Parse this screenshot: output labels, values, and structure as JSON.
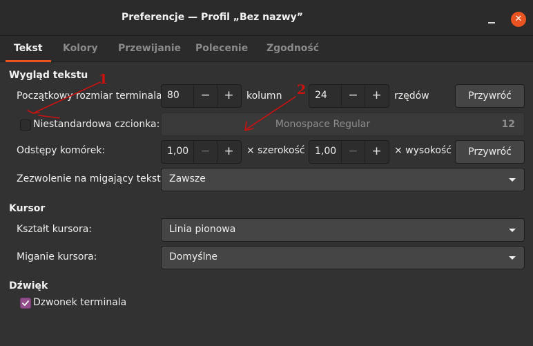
{
  "window": {
    "title": "Preferencje — Profil „Bez nazwy”",
    "minimize_glyph": "—",
    "close_glyph": "✕"
  },
  "tabs": [
    {
      "label": "Tekst",
      "active": true
    },
    {
      "label": "Kolory",
      "active": false
    },
    {
      "label": "Przewijanie",
      "active": false
    },
    {
      "label": "Polecenie",
      "active": false
    },
    {
      "label": "Zgodność",
      "active": false
    }
  ],
  "text_appearance": {
    "heading": "Wygląd tekstu",
    "initial_size_label": "Początkowy rozmiar terminala:",
    "columns_value": "80",
    "columns_unit": "kolumn",
    "rows_value": "24",
    "rows_unit": "rzędów",
    "size_reset_label": "Przywróć",
    "custom_font_label": "Niestandardowa czcionka:",
    "custom_font_checked": false,
    "font_name": "Monospace Regular",
    "font_size": "12",
    "cell_spacing_label": "Odstępy komórek:",
    "width_value": "1,00",
    "width_unit": "× szerokość",
    "height_value": "1,00",
    "height_unit": "× wysokość",
    "spacing_reset_label": "Przywróć",
    "blink_label": "Zezwolenie na migający tekst:",
    "blink_value": "Zawsze"
  },
  "cursor": {
    "heading": "Kursor",
    "shape_label": "Kształt kursora:",
    "shape_value": "Linia pionowa",
    "blink_label": "Miganie kursora:",
    "blink_value": "Domyślne"
  },
  "sound": {
    "heading": "Dźwięk",
    "bell_label": "Dzwonek terminala",
    "bell_checked": true
  },
  "spin_glyphs": {
    "minus": "−",
    "plus": "+"
  },
  "annotations": {
    "marker_1": "1",
    "marker_2": "2",
    "color": "#cc1111"
  },
  "colors": {
    "accent": "#e95420",
    "checkbox_checked": "#924d8b",
    "background": "#323232"
  }
}
